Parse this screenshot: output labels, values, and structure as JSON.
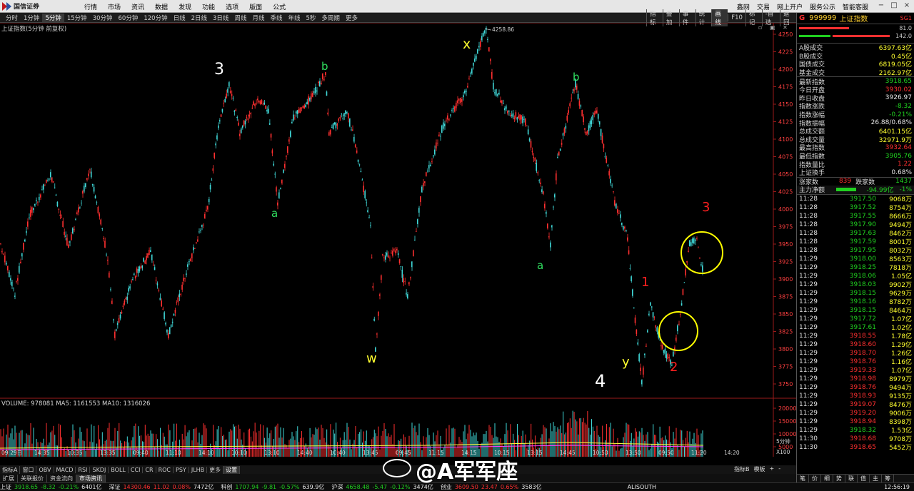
{
  "app": {
    "logo_text": "国信证券"
  },
  "menu": {
    "main": [
      "行情",
      "市场",
      "资讯",
      "数据",
      "发现",
      "功能",
      "选项",
      "版面",
      "公式"
    ],
    "right": [
      "鑫网",
      "交易",
      "网上开户",
      "服务公示",
      "智能客服"
    ]
  },
  "period_tabs": [
    "分时",
    "1分钟",
    "5分钟",
    "15分钟",
    "30分钟",
    "60分钟",
    "120分钟",
    "日线",
    "2日线",
    "3日线",
    "周线",
    "月线",
    "季线",
    "年线",
    "5秒",
    "多周期",
    "更多"
  ],
  "period_selected": "5分钟",
  "right_tools": [
    "指标",
    "叠加",
    "事件",
    "统计",
    "画线",
    "F10",
    "标记",
    "-自选",
    "返回"
  ],
  "chart": {
    "title": "上证指数(5分钟 前复权)",
    "high_label": "4258.86",
    "y_ticks": [
      "4250",
      "4225",
      "4200",
      "4175",
      "4150",
      "4125",
      "4100",
      "4075",
      "4050",
      "4025",
      "4000",
      "3975",
      "3950",
      "3925",
      "3900",
      "3875",
      "3850",
      "3825",
      "3800",
      "3775",
      "3750"
    ],
    "x_labels": [
      "09:29日",
      "14:35",
      "10:35",
      "13:35",
      "09:40",
      "11:10",
      "14:10",
      "10:10",
      "13:10",
      "14:40",
      "10:40",
      "13:45",
      "09:45",
      "11:15",
      "14:15",
      "10:15",
      "13:15",
      "14:45",
      "10:50",
      "13:50",
      "09:50",
      "11:20",
      "14:20"
    ],
    "annotations": [
      {
        "text": "3",
        "color": "#ffffff"
      },
      {
        "text": "a",
        "color": "#30e060"
      },
      {
        "text": "b",
        "color": "#30e060"
      },
      {
        "text": "w",
        "color": "#ffff30"
      },
      {
        "text": "x",
        "color": "#ffff30"
      },
      {
        "text": "a",
        "color": "#30e060"
      },
      {
        "text": "b",
        "color": "#30e060"
      },
      {
        "text": "y",
        "color": "#ffff30"
      },
      {
        "text": "4",
        "color": "#ffffff"
      },
      {
        "text": "1",
        "color": "#ff2020"
      },
      {
        "text": "2",
        "color": "#ff2020"
      },
      {
        "text": "3",
        "color": "#ff2020"
      }
    ],
    "volume_title": "VOLUME: 978081  MA5: 1161553  MA10: 1316026",
    "vol_ticks": [
      "20000",
      "15000",
      "10000",
      "5000"
    ],
    "vol_unit": "X100",
    "period_label": "5分钟"
  },
  "indicator_tabs": [
    "指标A",
    "窗口",
    "OBV",
    "MACD",
    "RSI",
    "SKDJ",
    "BOLL",
    "CCI",
    "CR",
    "ROC",
    "PSY",
    "JLHB",
    "更多",
    "设置"
  ],
  "indicator_selected": "设置",
  "ind_right": [
    "指标B",
    "模板",
    "+",
    "-"
  ],
  "toolbar2": [
    "扩展",
    "关联报价",
    "资金流向",
    "市场资讯"
  ],
  "toolbar2_selected": "市场资讯",
  "status": [
    {
      "name": "上证",
      "price": "3918.65",
      "chg": "-8.32",
      "pct": "-0.21%",
      "amt": "6401亿"
    },
    {
      "name": "深证",
      "price": "14300.46",
      "chg": "11.02",
      "pct": "0.08%",
      "amt": "7472亿"
    },
    {
      "name": "科创",
      "price": "1707.94",
      "chg": "-9.81",
      "pct": "-0.57%",
      "amt": "639.9亿"
    },
    {
      "name": "沪深",
      "price": "4658.48",
      "chg": "-5.47",
      "pct": "-0.12%",
      "amt": "3474亿"
    },
    {
      "name": "创业",
      "price": "3609.50",
      "chg": "23.47",
      "pct": "0.65%",
      "amt": "3583亿"
    }
  ],
  "status_right": {
    "server": "ALISOUTH",
    "clock": "12:56:19"
  },
  "panel": {
    "header": {
      "g": "G",
      "code": "999999",
      "name": "上证指数",
      "sg": "SG1"
    },
    "ratio_labels": [
      "81.0",
      "142.0"
    ],
    "rows1": [
      {
        "l": "A股成交",
        "v": "6397.63亿",
        "c": "#ffff30"
      },
      {
        "l": "B股成交",
        "v": "0.45亿",
        "c": "#ffff30"
      },
      {
        "l": "国债成交",
        "v": "6819.05亿",
        "c": "#ffff30"
      },
      {
        "l": "基金成交",
        "v": "2162.97亿",
        "c": "#ffff30"
      }
    ],
    "rows2": [
      {
        "l": "最新指数",
        "v": "3918.65",
        "c": "#20d020"
      },
      {
        "l": "今日开盘",
        "v": "3930.02",
        "c": "#ff3030"
      },
      {
        "l": "昨日收盘",
        "v": "3926.97",
        "c": "#e8e8e8"
      },
      {
        "l": "指数涨跌",
        "v": "-8.32",
        "c": "#20d020"
      },
      {
        "l": "指数涨幅",
        "v": "-0.21%",
        "c": "#20d020"
      },
      {
        "l": "指数振幅",
        "v": "26.88/0.68%",
        "c": "#e8e8e8"
      },
      {
        "l": "总成交额",
        "v": "6401.15亿",
        "c": "#ffff30"
      },
      {
        "l": "总成交量",
        "v": "32971.9万",
        "c": "#ffff30"
      },
      {
        "l": "最高指数",
        "v": "3932.64",
        "c": "#ff3030"
      },
      {
        "l": "最低指数",
        "v": "3905.76",
        "c": "#20d020"
      },
      {
        "l": "指数量比",
        "v": "1.22",
        "c": "#ff3030"
      },
      {
        "l": "上证换手",
        "v": "0.68%",
        "c": "#e8e8e8"
      }
    ],
    "updown": {
      "up_l": "涨家数",
      "up_v": "839",
      "down_l": "跌家数",
      "down_v": "1437"
    },
    "mainflow": {
      "l": "主力净额",
      "v": "-94.99亿",
      "p": "-1%"
    },
    "ticks": [
      [
        "11:28",
        "3917.50",
        "9068万"
      ],
      [
        "11:28",
        "3917.52",
        "8754万"
      ],
      [
        "11:28",
        "3917.55",
        "8666万"
      ],
      [
        "11:28",
        "3917.90",
        "9494万"
      ],
      [
        "11:28",
        "3917.63",
        "8462万"
      ],
      [
        "11:28",
        "3917.59",
        "8001万"
      ],
      [
        "11:28",
        "3917.95",
        "8032万"
      ],
      [
        "11:29",
        "3918.00",
        "8563万"
      ],
      [
        "11:29",
        "3918.25",
        "7818万"
      ],
      [
        "11:29",
        "3918.06",
        "1.05亿"
      ],
      [
        "11:29",
        "3918.03",
        "9902万"
      ],
      [
        "11:29",
        "3918.15",
        "9629万"
      ],
      [
        "11:29",
        "3918.16",
        "8782万"
      ],
      [
        "11:29",
        "3918.15",
        "8464万"
      ],
      [
        "11:29",
        "3917.72",
        "1.07亿"
      ],
      [
        "11:29",
        "3917.61",
        "1.02亿"
      ],
      [
        "11:29",
        "3918.55",
        "1.78亿"
      ],
      [
        "11:29",
        "3918.60",
        "1.29亿"
      ],
      [
        "11:29",
        "3918.70",
        "1.26亿"
      ],
      [
        "11:29",
        "3918.76",
        "1.16亿"
      ],
      [
        "11:29",
        "3919.33",
        "1.07亿"
      ],
      [
        "11:29",
        "3918.98",
        "8979万"
      ],
      [
        "11:29",
        "3918.76",
        "9494万"
      ],
      [
        "11:29",
        "3918.93",
        "9135万"
      ],
      [
        "11:29",
        "3919.07",
        "8476万"
      ],
      [
        "11:29",
        "3919.20",
        "9006万"
      ],
      [
        "11:29",
        "3918.94",
        "8398万"
      ],
      [
        "11:29",
        "3918.32",
        "1.53亿"
      ],
      [
        "11:30",
        "3918.68",
        "9708万"
      ],
      [
        "11:30",
        "3918.65",
        "5452万"
      ]
    ],
    "footer": [
      "笔",
      "价",
      "细",
      "势",
      "联",
      "值",
      "主",
      "筹"
    ]
  },
  "watermark": "@A军军座",
  "colors": {
    "candle_up": "#ff3030",
    "candle_down": "#40d8d8",
    "circle": "#ffff00"
  }
}
